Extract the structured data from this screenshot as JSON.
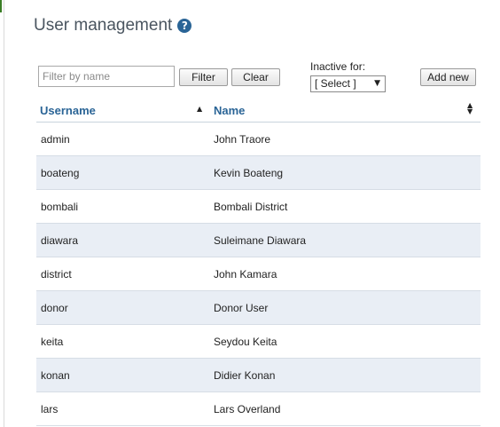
{
  "page": {
    "title": "User management",
    "help_icon": "question-circle-icon"
  },
  "toolbar": {
    "filter_placeholder": "Filter by name",
    "filter_value": "",
    "filter_label": "Filter",
    "clear_label": "Clear",
    "inactive_label": "Inactive for:",
    "inactive_selected": "[ Select ]",
    "add_new_label": "Add new"
  },
  "table": {
    "columns": [
      "Username",
      "Name"
    ],
    "sort_column": "Username",
    "sort_direction": "ascending",
    "rows": [
      {
        "username": "admin",
        "name": "John Traore"
      },
      {
        "username": "boateng",
        "name": "Kevin Boateng"
      },
      {
        "username": "bombali",
        "name": "Bombali District"
      },
      {
        "username": "diawara",
        "name": "Suleimane Diawara"
      },
      {
        "username": "district",
        "name": "John Kamara"
      },
      {
        "username": "donor",
        "name": "Donor User"
      },
      {
        "username": "keita",
        "name": "Seydou Keita"
      },
      {
        "username": "konan",
        "name": "Didier Konan"
      },
      {
        "username": "lars",
        "name": "Lars Overland"
      }
    ]
  },
  "colors": {
    "header_link": "#2a6496",
    "row_alt": "#e9eef5",
    "title": "#4a5560"
  }
}
